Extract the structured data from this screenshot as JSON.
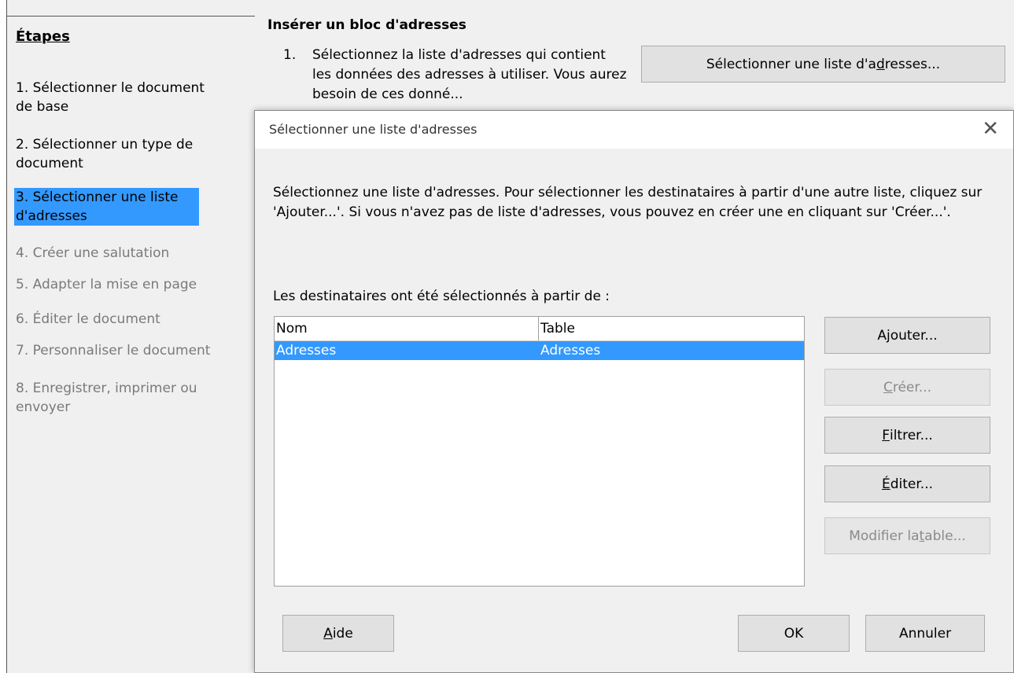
{
  "wizard": {
    "steps_title": "Étapes",
    "steps": [
      {
        "num": "1.",
        "label": "Sélectionner le document de base"
      },
      {
        "num": "2.",
        "label": "Sélectionner un type de document"
      },
      {
        "num": "3.",
        "label": "Sélectionner une liste d'adresses"
      },
      {
        "num": "4.",
        "label": "Créer une salutation"
      },
      {
        "num": "5.",
        "label": "Adapter la mise en page"
      },
      {
        "num": "6.",
        "label": "Éditer le document"
      },
      {
        "num": "7.",
        "label": "Personnaliser le document"
      },
      {
        "num": "8.",
        "label": "Enregistrer, imprimer ou envoyer"
      }
    ],
    "active_step": 3,
    "section_title": "Insérer un bloc d'adresses",
    "instruction_number": "1.",
    "instruction_text": "Sélectionnez la liste d'adresses qui contient les données des adresses à utiliser. Vous aurez besoin de ces donné...",
    "select_list_button": {
      "pre": "Sélectionner une liste d'a",
      "u": "d",
      "post": "resses..."
    }
  },
  "dialog": {
    "title": "Sélectionner une liste d'adresses",
    "close_glyph": "✕",
    "description": "Sélectionnez une liste d'adresses. Pour sélectionner les destinataires à partir d'une autre liste, cliquez sur 'Ajouter...'. Si vous n'avez pas de liste d'adresses, vous pouvez en créer une en cliquant sur 'Créer...'.",
    "list_label": "Les destinataires ont été sélectionnés à partir de :",
    "columns": [
      "Nom",
      "Table"
    ],
    "rows": [
      {
        "name": "Adresses",
        "table": "Adresses"
      }
    ],
    "buttons": {
      "add": {
        "pre": "A",
        "u": "j",
        "post": "outer..."
      },
      "create": {
        "pre": "",
        "u": "C",
        "post": "réer..."
      },
      "filter": {
        "pre": "",
        "u": "F",
        "post": "iltrer..."
      },
      "edit": {
        "pre": "",
        "u": "É",
        "post": "diter..."
      },
      "modify_table": {
        "pre": "Modifier la ",
        "u": "t",
        "post": "able..."
      },
      "help": {
        "pre": "",
        "u": "A",
        "post": "ide"
      },
      "ok": "OK",
      "cancel": "Annuler"
    },
    "colors": {
      "selection": "#3399ff",
      "dialog_bg": "#f0f0f0"
    }
  }
}
